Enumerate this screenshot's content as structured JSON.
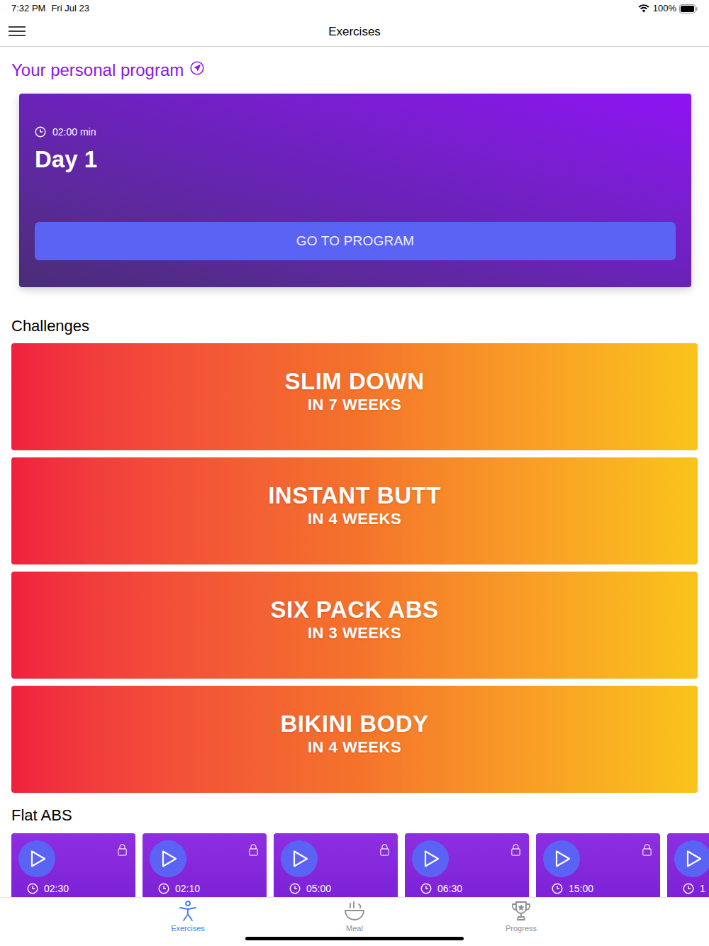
{
  "status_bar": {
    "time": "7:32 PM",
    "date": "Fri Jul 23",
    "battery": "100%"
  },
  "nav": {
    "title": "Exercises"
  },
  "program": {
    "heading": "Your personal program",
    "duration": "02:00 min",
    "day": "Day 1",
    "button": "GO TO PROGRAM"
  },
  "challenges": {
    "title": "Challenges",
    "items": [
      {
        "title": "SLIM DOWN",
        "subtitle": "IN 7 WEEKS"
      },
      {
        "title": "INSTANT BUTT",
        "subtitle": "IN 4 WEEKS"
      },
      {
        "title": "SIX PACK ABS",
        "subtitle": "IN 3 WEEKS"
      },
      {
        "title": "BIKINI BODY",
        "subtitle": "IN 4 WEEKS"
      }
    ]
  },
  "flat_abs": {
    "title": "Flat ABS",
    "videos": [
      {
        "duration": "02:30",
        "locked": true
      },
      {
        "duration": "02:10",
        "locked": true
      },
      {
        "duration": "05:00",
        "locked": true
      },
      {
        "duration": "06:30",
        "locked": true
      },
      {
        "duration": "15:00",
        "locked": true
      },
      {
        "duration": "1",
        "locked": false
      }
    ]
  },
  "tabs": [
    {
      "label": "Exercises",
      "selected": true
    },
    {
      "label": "Meal",
      "selected": false
    },
    {
      "label": "Progress",
      "selected": false
    }
  ]
}
